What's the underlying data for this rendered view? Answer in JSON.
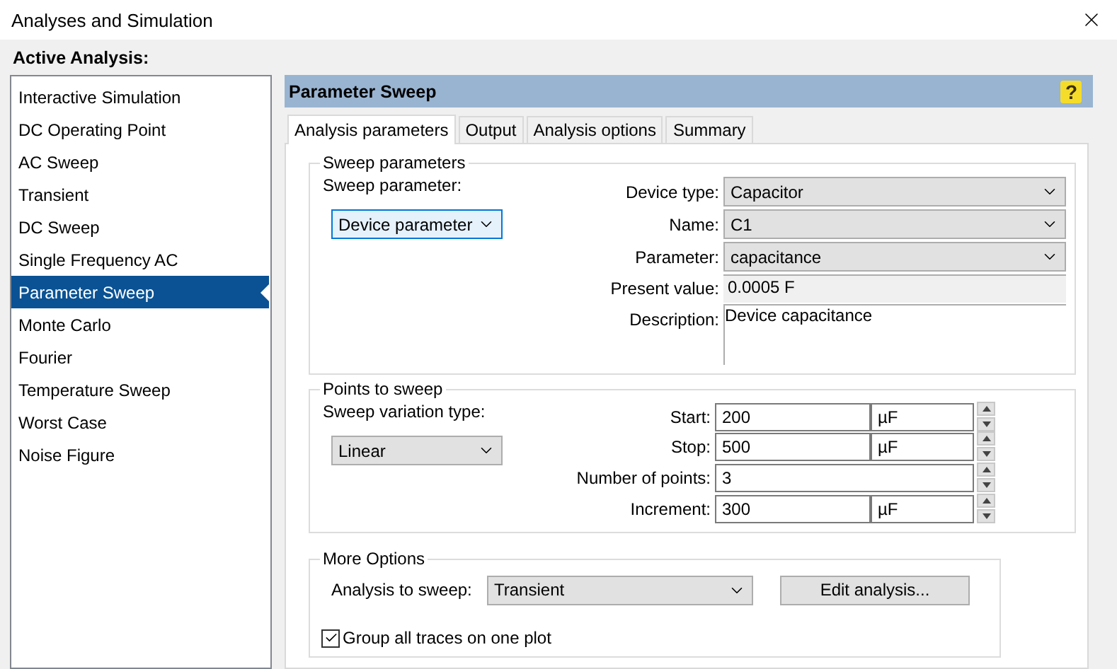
{
  "window": {
    "title": "Analyses and Simulation"
  },
  "sidebar": {
    "heading": "Active Analysis:",
    "items": [
      {
        "label": "Interactive Simulation",
        "selected": false
      },
      {
        "label": "DC Operating Point",
        "selected": false
      },
      {
        "label": "AC Sweep",
        "selected": false
      },
      {
        "label": "Transient",
        "selected": false
      },
      {
        "label": "DC Sweep",
        "selected": false
      },
      {
        "label": "Single Frequency AC",
        "selected": false
      },
      {
        "label": "Parameter Sweep",
        "selected": true
      },
      {
        "label": "Monte Carlo",
        "selected": false
      },
      {
        "label": "Fourier",
        "selected": false
      },
      {
        "label": "Temperature Sweep",
        "selected": false
      },
      {
        "label": "Worst Case",
        "selected": false
      },
      {
        "label": "Noise Figure",
        "selected": false
      }
    ]
  },
  "panel": {
    "title": "Parameter Sweep",
    "help": "?"
  },
  "tabs": [
    {
      "label": "Analysis parameters",
      "selected": true
    },
    {
      "label": "Output",
      "selected": false
    },
    {
      "label": "Analysis options",
      "selected": false
    },
    {
      "label": "Summary",
      "selected": false
    }
  ],
  "sweep_parameters": {
    "legend": "Sweep parameters",
    "sweep_parameter_label": "Sweep parameter:",
    "sweep_parameter": "Device parameter",
    "fields": [
      {
        "kind": "select",
        "label": "Device type:",
        "value": "Capacitor"
      },
      {
        "kind": "select",
        "label": "Name:",
        "value": "C1"
      },
      {
        "kind": "select",
        "label": "Parameter:",
        "value": "capacitance"
      },
      {
        "kind": "readonly",
        "label": "Present value:",
        "value": "0.0005 F"
      },
      {
        "kind": "textarea",
        "label": "Description:",
        "value": "Device capacitance"
      }
    ]
  },
  "points_to_sweep": {
    "legend": "Points to sweep",
    "variation_label": "Sweep variation type:",
    "variation": "Linear",
    "fields": [
      {
        "label": "Start:",
        "value": "200",
        "unit": "µF"
      },
      {
        "label": "Stop:",
        "value": "500",
        "unit": "µF"
      },
      {
        "label": "Number of points:",
        "value": "3"
      },
      {
        "label": "Increment:",
        "value": "300",
        "unit": "µF"
      }
    ]
  },
  "more_options": {
    "legend": "More Options",
    "analysis_label": "Analysis to sweep:",
    "analysis": "Transient",
    "edit_button": "Edit analysis...",
    "group_traces": {
      "label": "Group all traces on one plot",
      "checked": true
    }
  }
}
